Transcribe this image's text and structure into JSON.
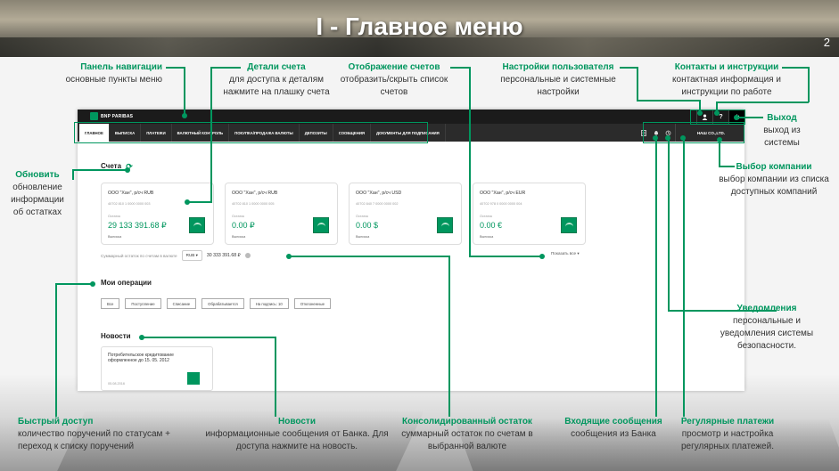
{
  "slide": {
    "title": "I - Главное меню",
    "number": "2"
  },
  "app": {
    "logo_text": "BNP PARIBAS",
    "user_icons": [
      "user-icon",
      "help-icon",
      "power-icon"
    ],
    "help_glyph": "?",
    "tabs": [
      "ГЛАВНОЕ",
      "ВЫПИСКА",
      "ПЛАТЕЖИ",
      "ВАЛЮТНЫЙ КОНТРОЛЬ",
      "ПОКУПКА/ПРОДАЖА ВАЛЮТЫ",
      "ДЕПОЗИТЫ",
      "СООБЩЕНИЯ",
      "ДОКУМЕНТЫ ДЛЯ ПОДПИСАНИЯ"
    ],
    "company": "НАШ CO.,LTD.",
    "accounts_title": "Счета",
    "accounts": [
      {
        "name": "ООО \"Хан\", р/сч RUB",
        "number": "40702 810 1 0000 0000 003",
        "label": "Остаток",
        "balance": "29 133 391.68 ₽",
        "statement": "Выписка"
      },
      {
        "name": "ООО \"Хан\", р/сч RUB",
        "number": "40702 810 1 0000 0000 005",
        "label": "Остаток",
        "balance": "0.00 ₽",
        "statement": "Выписка"
      },
      {
        "name": "ООО \"Хан\", р/сч USD",
        "number": "40702 840 7 0000 0000 002",
        "label": "Остаток",
        "balance": "0.00 $",
        "statement": "Выписка"
      },
      {
        "name": "ООО \"Хан\", р/сч EUR",
        "number": "40702 978 0 0000 0000 004",
        "label": "Остаток",
        "balance": "0.00 €",
        "statement": "Выписка"
      }
    ],
    "summary_label": "Суммарный остаток по счетам в валюте",
    "currency": "RUB",
    "summary_value": "30 333 391.68 ₽",
    "show_all": "Показать все",
    "operations_title": "Мои операции",
    "operations": [
      "Все",
      "Поступление",
      "Списание",
      "Обрабатывается",
      "На подпись: 10",
      "Отклоненные"
    ],
    "news_title": "Новости",
    "news": {
      "text": "Потребительское кредитование оформленное до 15. 05. 2012",
      "date": "05.08.2016"
    }
  },
  "callouts": {
    "nav": {
      "title": "Панель навигации",
      "desc": "основные пункты меню"
    },
    "details": {
      "title": "Детали счета",
      "desc": "для доступа к деталям нажмите на плашку счета"
    },
    "display": {
      "title": "Отображение счетов",
      "desc": "отобразить/скрыть список счетов"
    },
    "settings": {
      "title": "Настройки пользователя",
      "desc": "персональные и системные настройки"
    },
    "contacts": {
      "title": "Контакты и инструкции",
      "desc": "контактная информация и инструкции по работе"
    },
    "exit": {
      "title": "Выход",
      "desc": "выход из системы"
    },
    "refresh": {
      "title": "Обновить",
      "desc": "обновление информации об остатках"
    },
    "company": {
      "title": "Выбор компании",
      "desc": "выбор компании из списка доступных компаний"
    },
    "notify": {
      "title": "Уведомления",
      "desc": "персональные и уведомления системы безопасности."
    },
    "quick": {
      "title": "Быстрый доступ",
      "desc": "количество поручений по статусам + переход к списку поручений"
    },
    "news": {
      "title": "Новости",
      "desc": "информационные сообщения от Банка. Для доступа нажмите на новость."
    },
    "consolidated": {
      "title": "Консолидированный остаток",
      "desc": "суммарный остаток по счетам в выбранной валюте"
    },
    "inbox": {
      "title": "Входящие сообщения",
      "desc": "сообщения из Банка"
    },
    "recurring": {
      "title": "Регулярные платежи",
      "desc": "просмотр и настройка регулярных платежей."
    }
  }
}
